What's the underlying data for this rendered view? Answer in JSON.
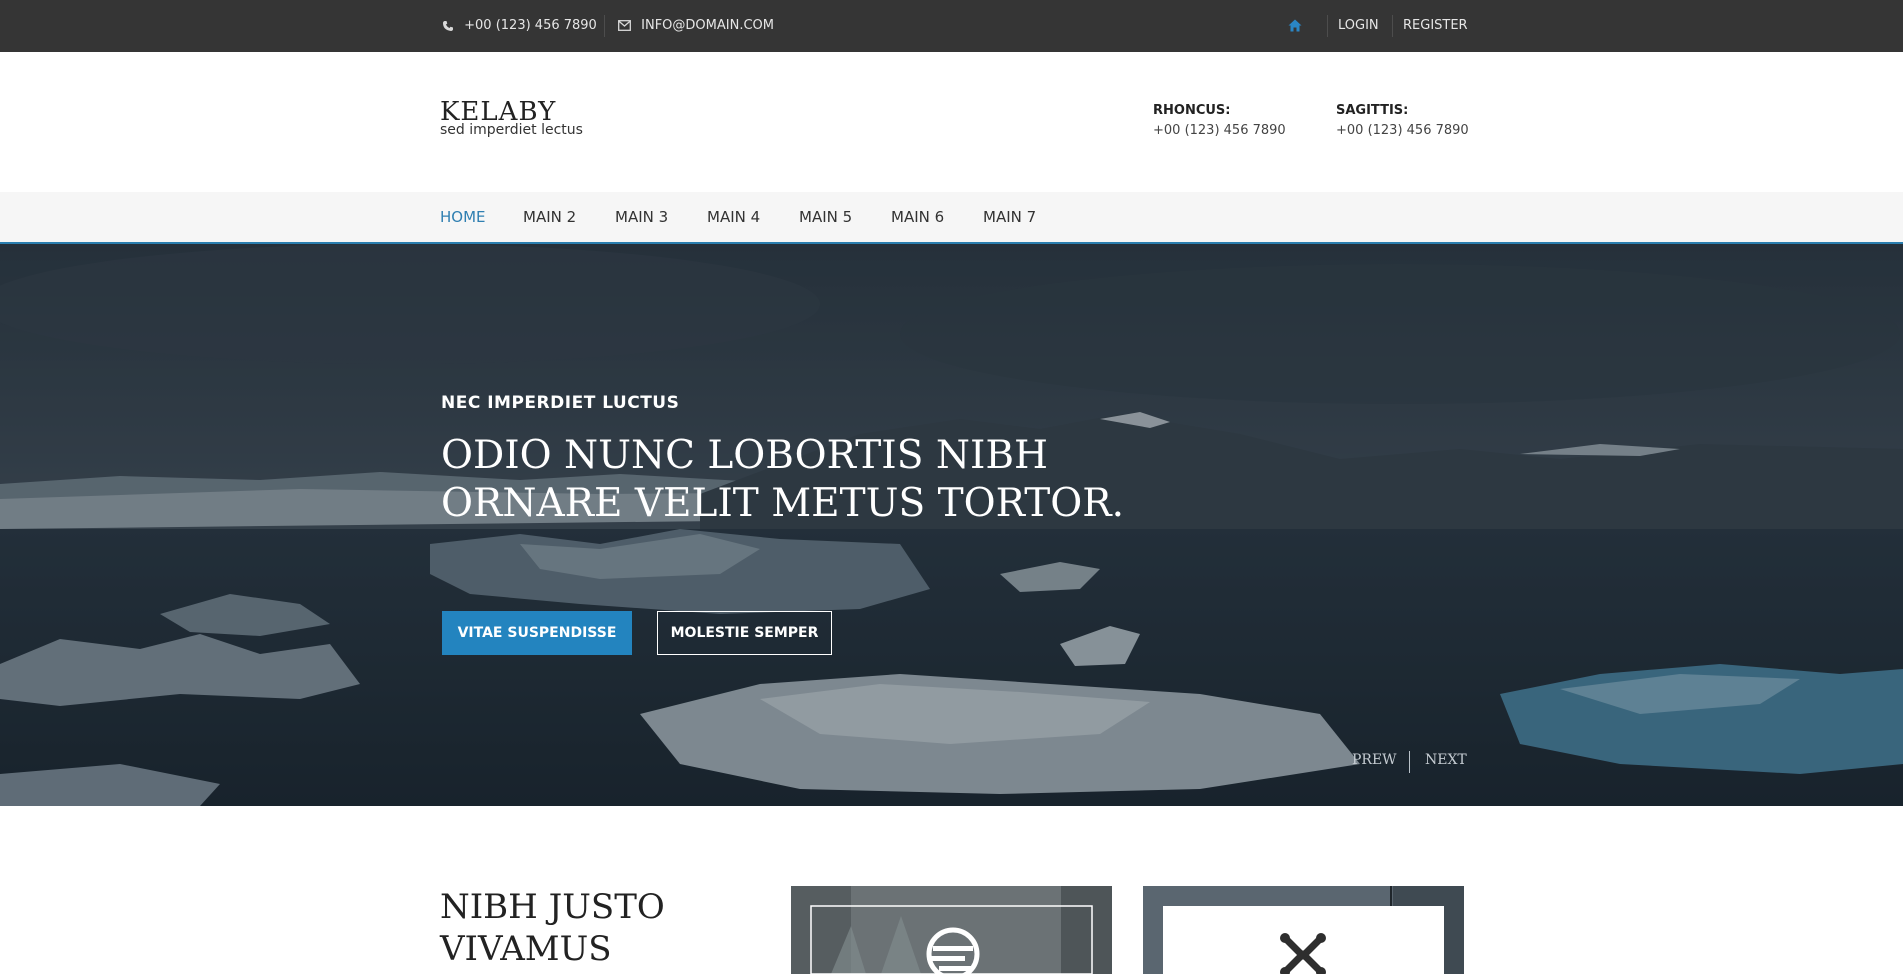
{
  "topbar": {
    "phone": "+00 (123) 456 7890",
    "email": "INFO@DOMAIN.COM",
    "login": "LOGIN",
    "register": "REGISTER",
    "accent": "#2a86c5"
  },
  "header": {
    "logo": "KELABY",
    "tagline": "sed imperdiet lectus",
    "contacts": [
      {
        "label": "RHONCUS:",
        "phone": "+00 (123) 456 7890"
      },
      {
        "label": "SAGITTIS:",
        "phone": "+00 (123) 456 7890"
      }
    ]
  },
  "nav": {
    "items": [
      "HOME",
      "MAIN 2",
      "MAIN 3",
      "MAIN 4",
      "MAIN 5",
      "MAIN 6",
      "MAIN 7"
    ],
    "active": "HOME",
    "active_color": "#2f7fb1"
  },
  "hero": {
    "kicker": "NEC IMPERDIET LUCTUS",
    "title": "ODIO NUNC LOBORTIS NIBH ORNARE VELIT METUS TORTOR.",
    "primary_button": "VITAE SUSPENDISSE",
    "secondary_button": "MOLESTIE SEMPER",
    "prev": "PREW",
    "next": "NEXT",
    "button_color": "#2384bf"
  },
  "section": {
    "title": "NIBH JUSTO VIVAMUS"
  }
}
